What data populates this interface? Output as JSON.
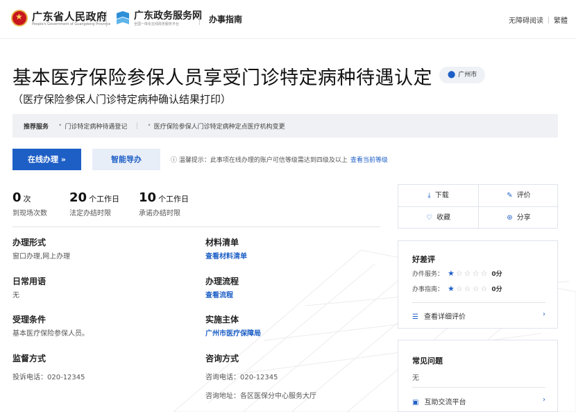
{
  "header": {
    "gov_name": "广东省人民政府",
    "gov_name_en": "People's Government of Guangdong Province",
    "service_name": "广东政务服务网",
    "service_sub": "全国一体化在线政务服务平台",
    "section": "办事指南",
    "accessibility": "无障碍阅读",
    "traditional": "繁體"
  },
  "page": {
    "title": "基本医疗保险参保人员享受门诊特定病种待遇认定",
    "location": "广州市",
    "subtitle": "（医疗保险参保人门诊特定病种确认结果打印）"
  },
  "recommend": {
    "label": "推荐服务",
    "items": [
      "门诊特定病种待遇登记",
      "医疗保险参保人门诊特定病种定点医疗机构变更"
    ]
  },
  "actions": {
    "online": "在线办理 »",
    "smart_guide": "智能导办",
    "tip_text": "温馨提示：此事项在线办理的账户可信等级需达到四级及以上",
    "tip_link": "查看当前等级"
  },
  "stats": [
    {
      "num": "0",
      "unit": "次",
      "label": "到现场次数"
    },
    {
      "num": "20",
      "unit": "个工作日",
      "label": "法定办结时限"
    },
    {
      "num": "10",
      "unit": "个工作日",
      "label": "承诺办结时限"
    }
  ],
  "fields": {
    "mode_k": "办理形式",
    "mode_v": "窗口办理,网上办理",
    "materials_k": "材料清单",
    "materials_v": "查看材料清单",
    "phrase_k": "日常用语",
    "phrase_v": "无",
    "flow_k": "办理流程",
    "flow_v": "查看流程",
    "cond_k": "受理条件",
    "cond_v": "基本医疗保险参保人员。",
    "subject_k": "实施主体",
    "subject_v": "广州市医疗保障局",
    "super_k": "监督方式",
    "super_v": "投诉电话：020-12345",
    "consult_k": "咨询方式",
    "consult_phone": "咨询电话：020-12345",
    "consult_addr": "咨询地址：各区医保分中心服务大厅"
  },
  "side": {
    "download": "下载",
    "rate": "评价",
    "collect": "收藏",
    "share": "分享",
    "rating_title": "好差评",
    "service_label": "办件服务：",
    "service_score": "0分",
    "service_stars": 1,
    "guide_label": "办事指南：",
    "guide_score": "0分",
    "guide_stars": 1,
    "detail_link": "查看详细评价",
    "faq_title": "常见问题",
    "faq_value": "无",
    "forum_link": "互助交流平台"
  },
  "colors": {
    "accent": "#1e5fc6",
    "recommend_bg": "#f0f1f4"
  }
}
